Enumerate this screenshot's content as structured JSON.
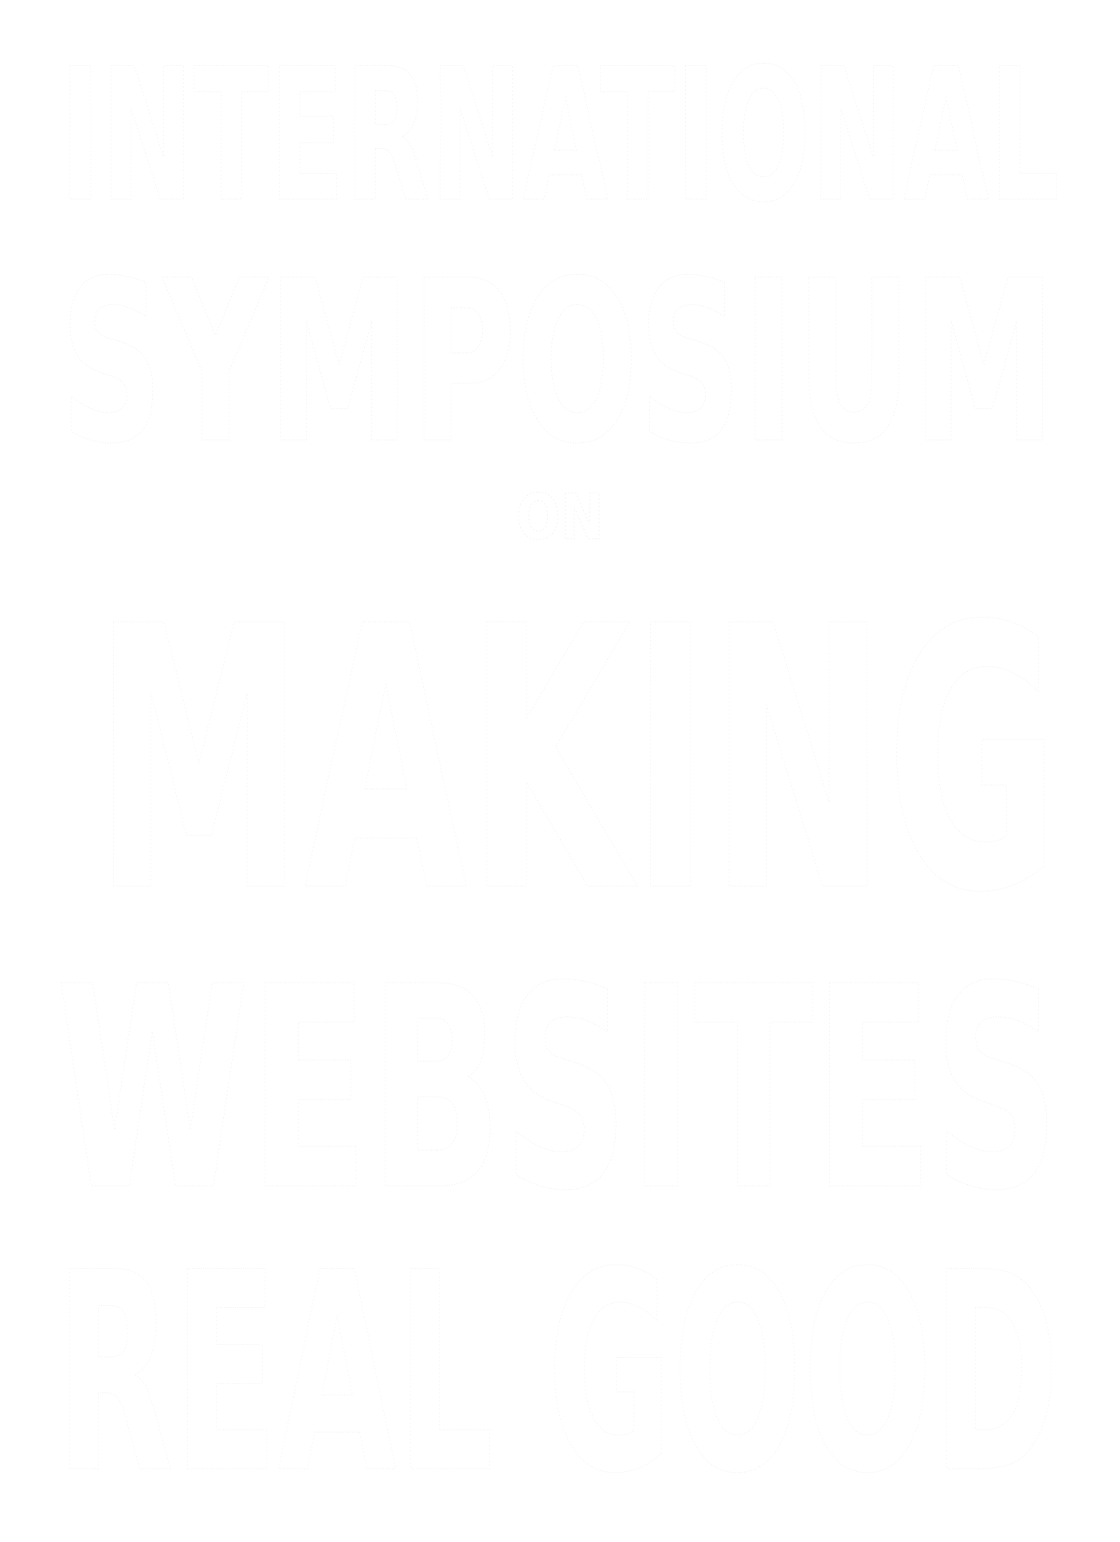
{
  "poster": {
    "lines": [
      "INTERNATIONAL",
      "SYMPOSIUM",
      "ON",
      "MAKING",
      "WEBSITES",
      "REAL GOOD"
    ]
  },
  "colors": {
    "background": "#ffffff",
    "text": "#ffffff"
  }
}
